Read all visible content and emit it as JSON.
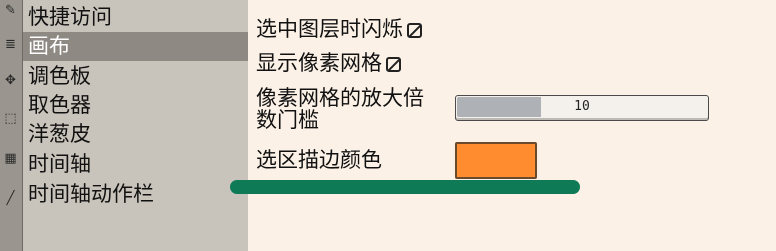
{
  "tool_icons": [
    "brush-icon",
    "layers-icon",
    "move-icon",
    "select-icon",
    "fill-icon",
    "line-icon"
  ],
  "sidebar": {
    "items": [
      {
        "label": "快捷访问"
      },
      {
        "label": "画布",
        "selected": true
      },
      {
        "label": "调色板"
      },
      {
        "label": "取色器"
      },
      {
        "label": "洋葱皮"
      },
      {
        "label": "时间轴"
      },
      {
        "label": "时间轴动作栏"
      }
    ]
  },
  "settings": {
    "flash_selected_layer": {
      "label": "选中图层时闪烁",
      "checked": true
    },
    "show_pixel_grid": {
      "label": "显示像素网格",
      "checked": true
    },
    "pixel_grid_zoom_threshold": {
      "label_line1": "像素网格的放大倍",
      "label_line2": "数门槛",
      "value": "10"
    },
    "selection_border_color": {
      "label": "选区描边颜色",
      "color": "#ff8c2e"
    }
  },
  "colors": {
    "background": "#fbf1e6",
    "sidebar": "#c9c4bb",
    "selected_item": "#8e8a83",
    "annotation": "#0e7a56"
  }
}
